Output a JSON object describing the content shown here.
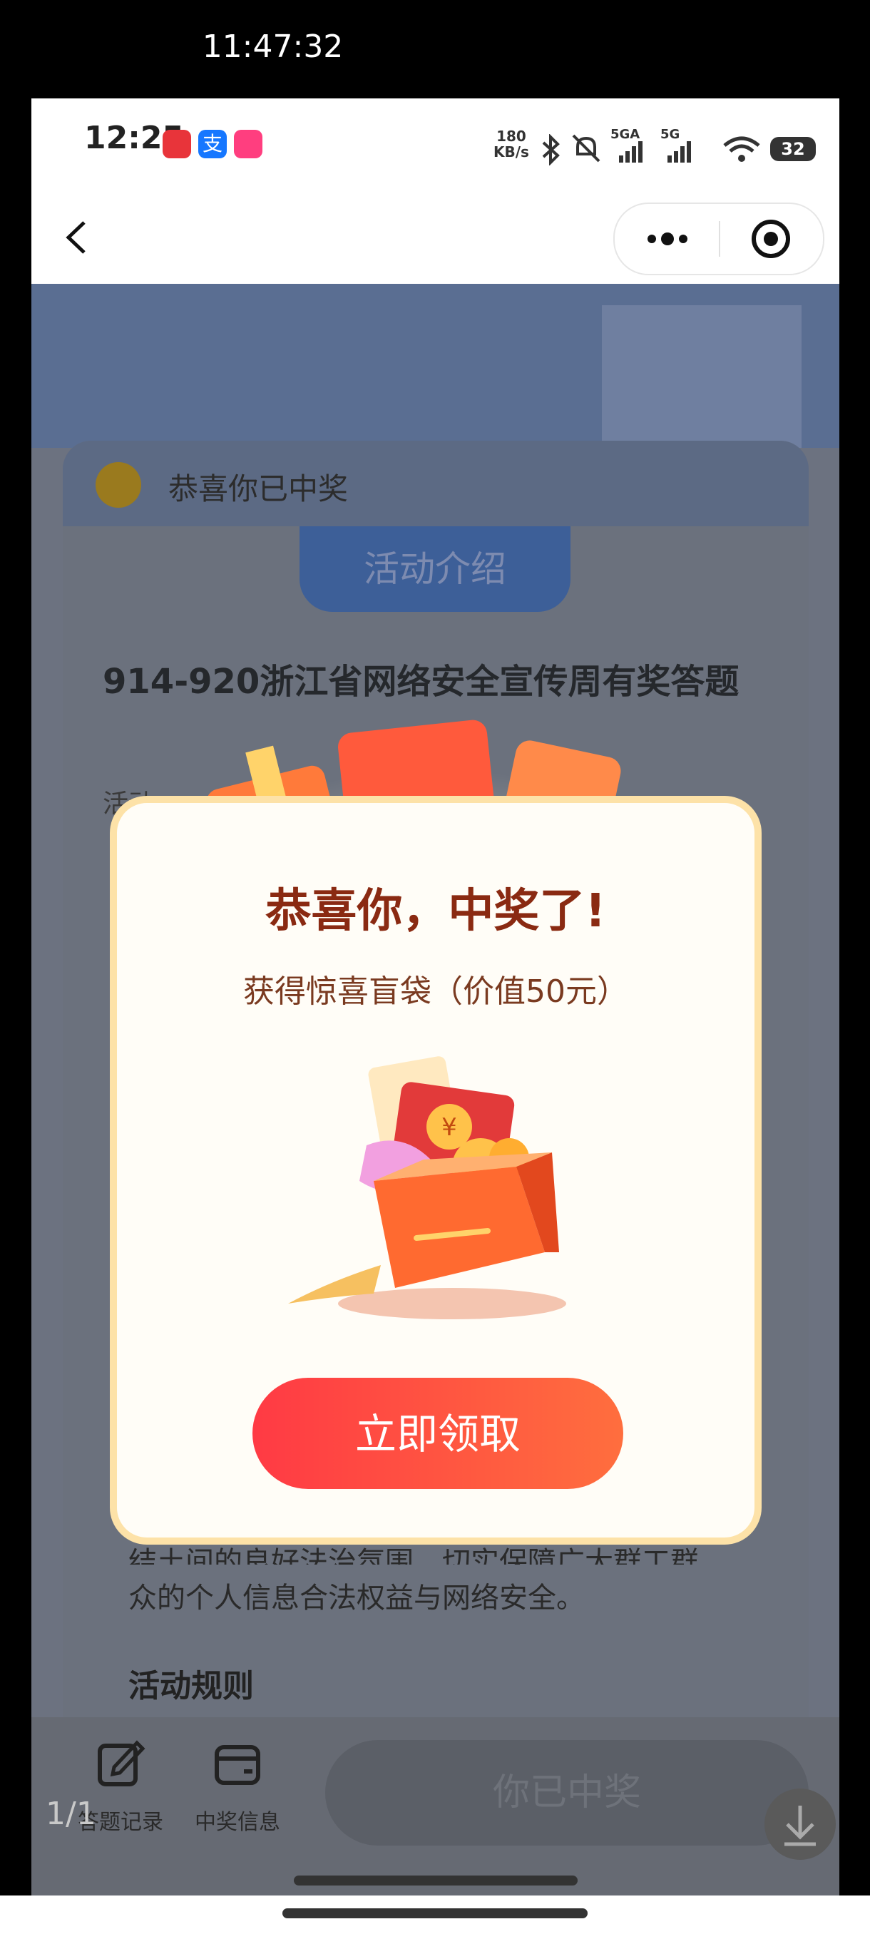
{
  "viewer": {
    "time": "11:47:32",
    "counter": "1/1"
  },
  "status_bar": {
    "time": "12:25",
    "net_speed_value": "180",
    "net_speed_unit": "KB/s",
    "signal_1": "5GA",
    "signal_2": "5G",
    "battery": "32"
  },
  "background": {
    "notice": "恭喜你已中奖",
    "tab": "活动介绍",
    "title": "914-920浙江省网络安全宣传周有奖答题",
    "label_fragment": "活动",
    "paragraph_line1": "结土间的良好法治氛围，切实保障广大群工群",
    "paragraph_line2": "众的个人信息合法权益与网络安全。",
    "rules_heading": "活动规则",
    "toolbar": {
      "answer_records": "答题记录",
      "prize_info": "中奖信息",
      "won_button": "你已中奖"
    }
  },
  "modal": {
    "title": "恭喜你，中奖了!",
    "subtitle": "获得惊喜盲袋（价值50元）",
    "claim_button": "立即领取"
  },
  "colors": {
    "claim_start": "#ff3a44",
    "claim_end": "#ff6e3e",
    "title": "#8a2a12",
    "modal_border": "#fde2a8"
  }
}
